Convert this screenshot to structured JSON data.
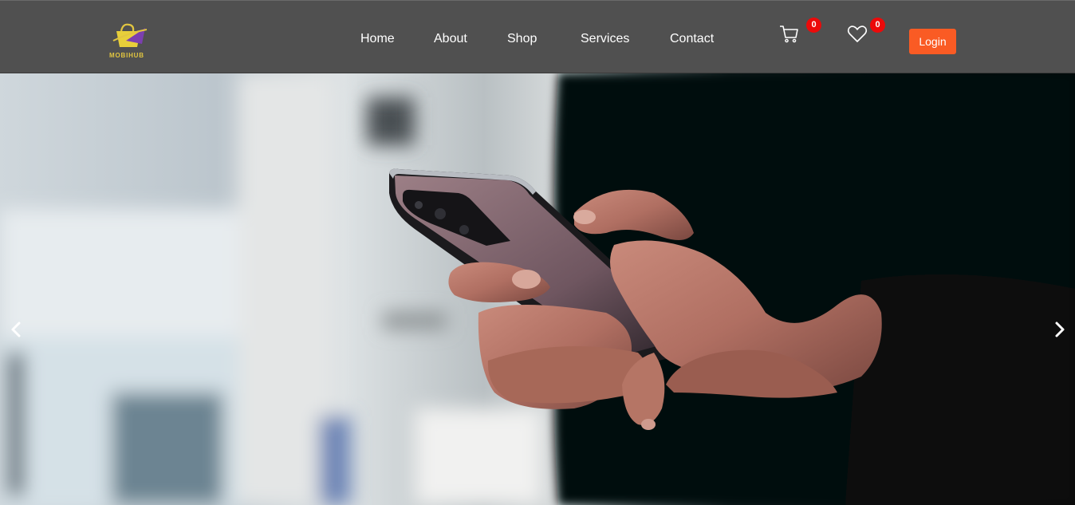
{
  "brand": {
    "name": "MOBIHUB",
    "logo_color": "#e2c640"
  },
  "nav": {
    "links": [
      {
        "label": "Home"
      },
      {
        "label": "About"
      },
      {
        "label": "Shop"
      },
      {
        "label": "Services"
      },
      {
        "label": "Contact"
      }
    ],
    "cart": {
      "icon": "cart-icon",
      "count": "0"
    },
    "wishlist": {
      "icon": "heart-icon",
      "count": "0"
    },
    "login_label": "Login"
  },
  "hero": {
    "image": "hand-holding-smartphone",
    "prev_icon": "chevron-left-icon",
    "next_icon": "chevron-right-icon"
  },
  "colors": {
    "navbar_bg": "#505050",
    "login_bg": "#fa5b24",
    "badge_bg": "#ec0a0a"
  }
}
